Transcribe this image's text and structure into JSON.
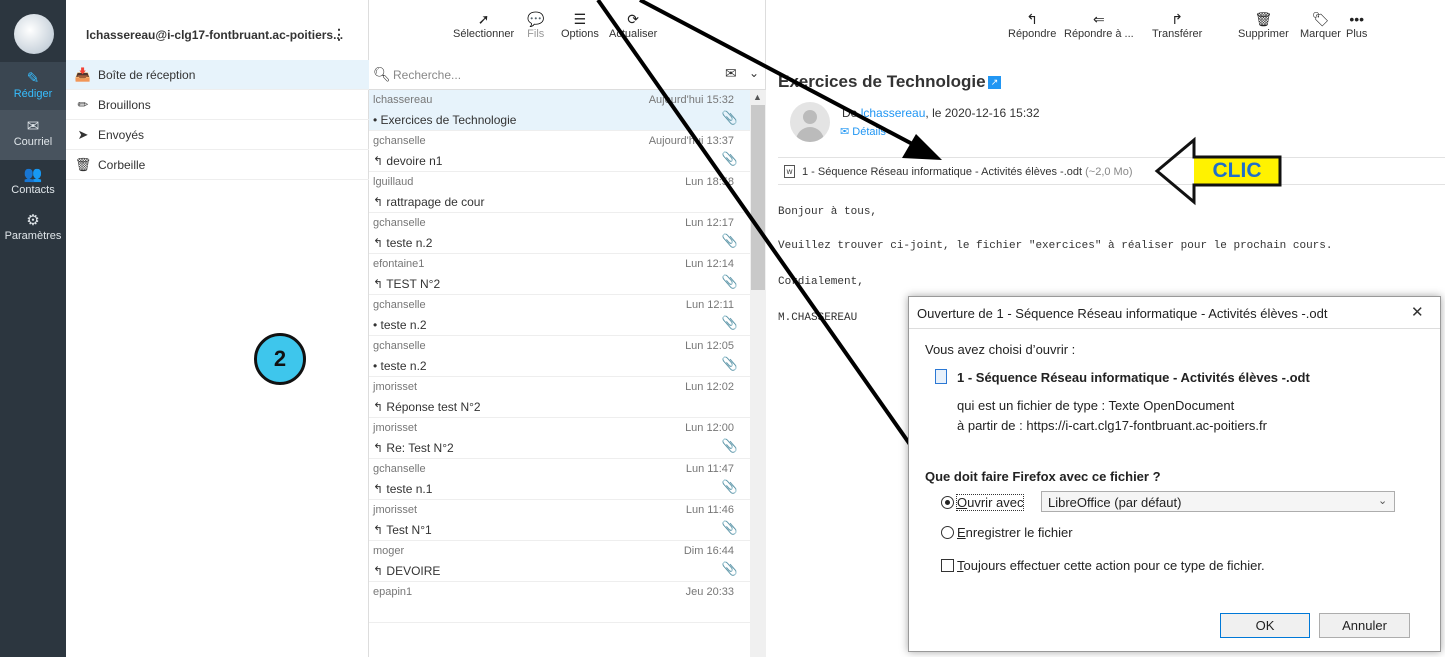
{
  "nav": {
    "items": [
      {
        "label": "Rédiger",
        "icon": "compose-icon"
      },
      {
        "label": "Courriel",
        "icon": "envelope-icon"
      },
      {
        "label": "Contacts",
        "icon": "users-icon"
      },
      {
        "label": "Paramètres",
        "icon": "gear-icon"
      }
    ]
  },
  "account": {
    "email": "lchassereau@i-clg17-fontbruant.ac-poitiers...",
    "menu": "⋮"
  },
  "folders": [
    {
      "label": "Boîte de réception",
      "icon": "inbox-icon"
    },
    {
      "label": "Brouillons",
      "icon": "pencil-icon"
    },
    {
      "label": "Envoyés",
      "icon": "paper-plane-icon"
    },
    {
      "label": "Corbeille",
      "icon": "trash-icon"
    }
  ],
  "list_toolbar": {
    "select": "Sélectionner",
    "threads": "Fils",
    "options": "Options",
    "refresh": "Actualiser"
  },
  "search": {
    "placeholder": "Recherche..."
  },
  "messages": [
    {
      "from": "lchassereau",
      "date": "Aujourd'hui 15:32",
      "subject": "Exercices de Technologie",
      "mark": "•",
      "clip": "📎"
    },
    {
      "from": "gchanselle",
      "date": "Aujourd'hui 13:37",
      "subject": "devoire n1",
      "mark": "↰",
      "clip": "📎"
    },
    {
      "from": "lguillaud",
      "date": "Lun 18:58",
      "subject": "rattrapage de cour",
      "mark": "↰",
      "clip": ""
    },
    {
      "from": "gchanselle",
      "date": "Lun 12:17",
      "subject": "teste n.2",
      "mark": "↰",
      "clip": "📎"
    },
    {
      "from": "efontaine1",
      "date": "Lun 12:14",
      "subject": "TEST N°2",
      "mark": "↰",
      "clip": "📎"
    },
    {
      "from": "gchanselle",
      "date": "Lun 12:11",
      "subject": "teste n.2",
      "mark": "•",
      "clip": "📎"
    },
    {
      "from": "gchanselle",
      "date": "Lun 12:05",
      "subject": "teste n.2",
      "mark": "•",
      "clip": "📎"
    },
    {
      "from": "jmorisset",
      "date": "Lun 12:02",
      "subject": "Réponse test N°2",
      "mark": "↰",
      "clip": ""
    },
    {
      "from": "jmorisset",
      "date": "Lun 12:00",
      "subject": "Re: Test N°2",
      "mark": "↰",
      "clip": "📎"
    },
    {
      "from": "gchanselle",
      "date": "Lun 11:47",
      "subject": "teste n.1",
      "mark": "↰",
      "clip": "📎"
    },
    {
      "from": "jmorisset",
      "date": "Lun 11:46",
      "subject": "Test N°1",
      "mark": "↰",
      "clip": "📎"
    },
    {
      "from": "moger",
      "date": "Dim 16:44",
      "subject": "DEVOIRE",
      "mark": "↰",
      "clip": "📎"
    },
    {
      "from": "epapin1",
      "date": "Jeu 20:33",
      "subject": "",
      "mark": "",
      "clip": ""
    }
  ],
  "reader_toolbar": {
    "reply": "Répondre",
    "reply_all": "Répondre à ...",
    "forward": "Transférer",
    "delete": "Supprimer",
    "mark": "Marquer",
    "more": "Plus"
  },
  "email": {
    "title": "Exercices de Technologie",
    "from_prefix": "De",
    "from_name": "lchassereau",
    "from_date": ", le 2020-12-16 15:32",
    "details": "Détails",
    "attachment_name": "1 - Séquence Réseau informatique - Activités élèves -.odt",
    "attachment_size": "(~2,0 Mo)",
    "body": [
      "Bonjour à tous,",
      "Veuillez trouver ci-joint, le fichier \"exercices\" à réaliser pour le prochain cours.",
      "Cordialement,",
      "M.CHASSEREAU"
    ]
  },
  "annotations": {
    "clic": "CLIC",
    "step": "2"
  },
  "dialog": {
    "title": "Ouverture de 1 - Séquence Réseau informatique - Activités élèves -.odt",
    "close": "✕",
    "chose": "Vous avez choisi d’ouvrir :",
    "filename": "1 - Séquence Réseau informatique - Activités élèves -.odt",
    "type_line": "qui est un fichier de type : Texte OpenDocument",
    "from_line": "à partir de : https://i-cart.clg17-fontbruant.ac-poitiers.fr",
    "question": "Que doit faire Firefox avec ce fichier ?",
    "open_with": "Ouvrir avec",
    "app": "LibreOffice (par défaut)",
    "save": "Enregistrer le fichier",
    "always": "Toujours effectuer cette action pour ce type de fichier.",
    "ok": "OK",
    "cancel": "Annuler"
  },
  "colors": {
    "accent": "#37beff",
    "link": "#2196f3",
    "clic_bg": "#fff200",
    "step_bg": "#3ec6ec"
  }
}
